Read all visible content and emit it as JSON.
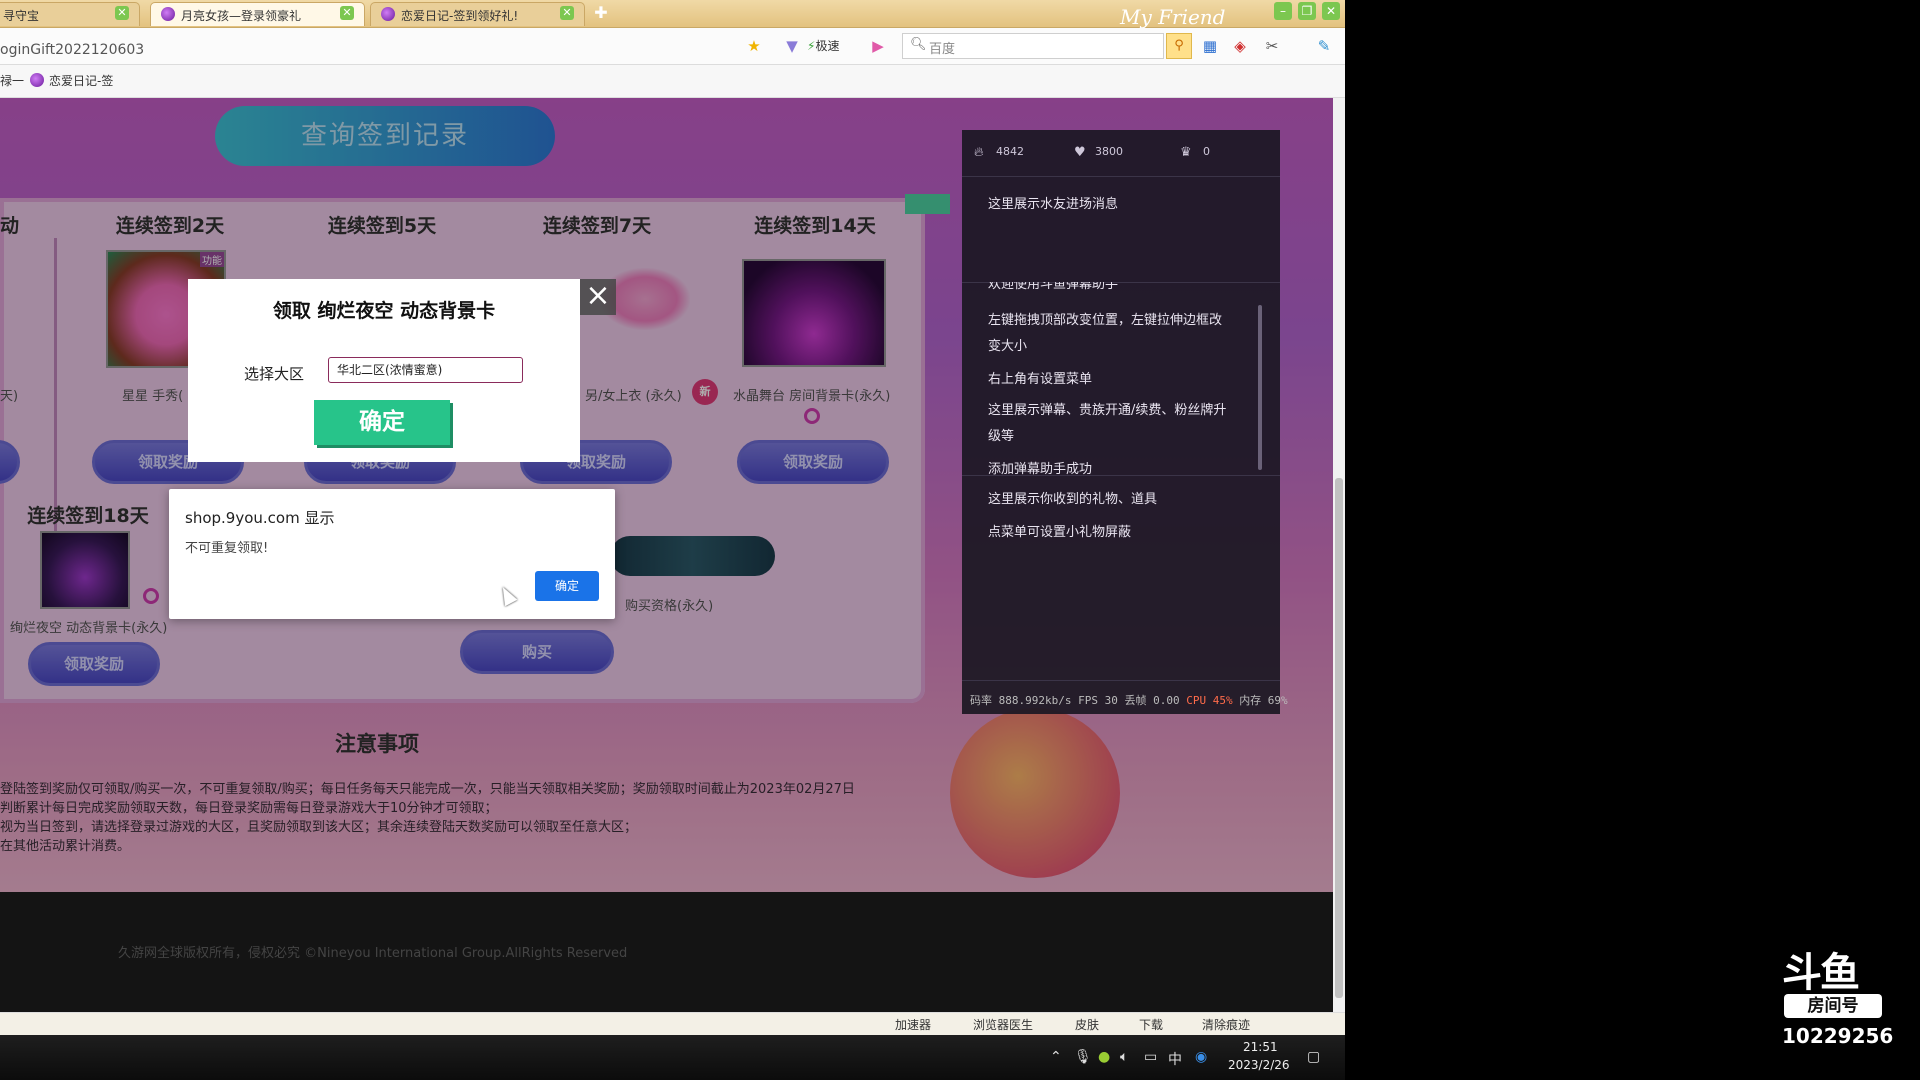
{
  "browser": {
    "tabs": [
      {
        "label": "寻守宝",
        "active": false
      },
      {
        "label": "月亮女孩—登录领豪礼",
        "active": true
      },
      {
        "label": "恋爱日记-签到领好礼!",
        "active": false
      }
    ],
    "url": "oginGift2022120603",
    "speed_label": "极速",
    "search_placeholder": "百度",
    "bookmarks": [
      "禄一",
      "恋爱日记-签"
    ],
    "tabbar_art_text": "My Friend"
  },
  "page": {
    "query_button": "查询签到记录",
    "days": [
      {
        "title": "连续签到2天",
        "item": "星星 手秀(",
        "button": "领取奖励"
      },
      {
        "title": "连续签到5天",
        "item": "",
        "button": "领取奖励"
      },
      {
        "title": "连续签到7天",
        "item": "另/女上衣 (永久)",
        "button": "领取奖励"
      },
      {
        "title": "连续签到14天",
        "item": "水晶舞台 房间背景卡(永久)",
        "button": "领取奖励"
      },
      {
        "title": "连续签到18天",
        "item": "绚烂夜空 动态背景卡(永久)",
        "button": "领取奖励"
      }
    ],
    "partial_left_title": "动",
    "partial_left_text": "天)",
    "new_badge": "新",
    "item_tag": "功能",
    "purchase_item": "购买资格(永久)",
    "buy_button": "购买",
    "notes_title": "注意事项",
    "notes": [
      "登陆签到奖励仅可领取/购买一次，不可重复领取/购买；每日任务每天只能完成一次，只能当天领取相关奖励；奖励领取时间截止为2023年02月27日",
      "判断累计每日完成奖励领取天数，每日登录奖励需每日登录游戏大于10分钟才可领取；",
      "视为当日签到，请选择登录过游戏的大区，且奖励领取到该大区；其余连续登陆天数奖励可以领取至任意大区；",
      "在其他活动累计消费。"
    ],
    "footer": "久游网全球版权所有，侵权必究 ©Nineyou International Group.AllRights Reserved"
  },
  "claim_modal": {
    "title": "领取 绚烂夜空 动态背景卡",
    "server_label": "选择大区",
    "server_value": "华北二区(浓情蜜意)",
    "confirm": "确定"
  },
  "alert": {
    "title": "shop.9you.com 显示",
    "message": "不可重复领取!",
    "ok": "确定"
  },
  "overlay": {
    "stats": {
      "fire": "4842",
      "heart": "3800",
      "crown": "0"
    },
    "lines": [
      "这里展示水友进场消息",
      "欢迎使用斗鱼弹幕助手",
      "左键拖拽顶部改变位置，左键拉伸边框改",
      "变大小",
      "右上角有设置菜单",
      "这里展示弹幕、贵族开通/续费、粉丝牌升",
      "级等",
      "添加弹幕助手成功",
      "这里展示你收到的礼物、道具",
      "点菜单可设置小礼物屏蔽"
    ],
    "perf": {
      "pre": "码率 888.992kb/s FPS 30 丢帧 0.00",
      "cpu": "CPU 45%",
      "post": "内存 69%"
    }
  },
  "statusbar": [
    "加速器",
    "浏览器医生",
    "皮肤",
    "下载",
    "清除痕迹"
  ],
  "taskbar": {
    "ime": "中",
    "time": "21:51",
    "date": "2023/2/26"
  },
  "watermark": {
    "logo": "斗鱼",
    "room_label": "房间号",
    "room_id": "10229256"
  },
  "colors": {
    "accent_green": "#27c48a",
    "alert_button": "#1a73e8",
    "page_purple": "#b566d1"
  }
}
